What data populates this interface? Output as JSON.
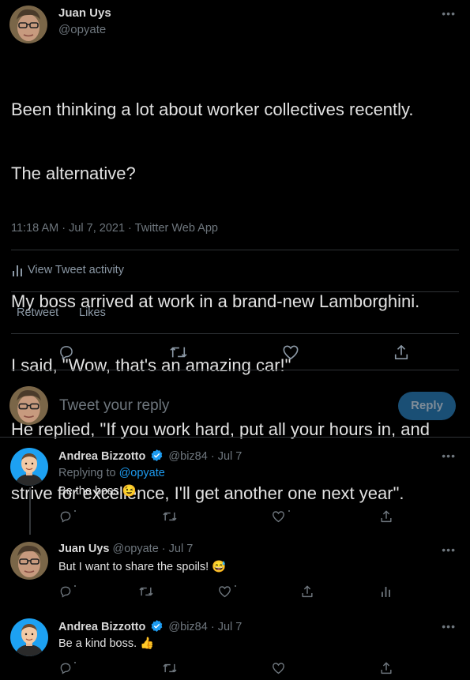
{
  "main_tweet": {
    "author": "Juan Uys",
    "handle": "@opyate",
    "lines": [
      "Been thinking a lot about worker collectives recently.",
      "The alternative?",
      "",
      "My boss arrived at work in a brand-new Lamborghini.",
      "I said, \"Wow, that's an amazing car!\"",
      "He replied, \"If you work hard, put all your hours in, and",
      "strive for excellence, I'll get another one next year\"."
    ],
    "meta": "11:18 AM · Jul 7, 2021 · Twitter Web App",
    "activity_label": "View Tweet activity",
    "stats": {
      "retweet_label": "Retweet",
      "likes_label": "Likes"
    }
  },
  "composer": {
    "placeholder": "Tweet your reply",
    "button_label": "Reply"
  },
  "replies": [
    {
      "author": "Andrea Bizzotto",
      "verified": true,
      "handle_date": "@biz84 · Jul 7",
      "replying_prefix": "Replying to",
      "replying_handle": "@opyate",
      "text": "Be the boss",
      "emoji": "😉"
    },
    {
      "author": "Juan Uys",
      "verified": false,
      "handle_date": "@opyate · Jul 7",
      "text": "But I want to share the spoils!",
      "emoji": "😅"
    },
    {
      "author": "Andrea Bizzotto",
      "verified": true,
      "handle_date": "@biz84 · Jul 7",
      "text": "Be a kind boss.",
      "emoji": "👍"
    }
  ],
  "colors": {
    "background": "#000000",
    "text": "#d9d9d9",
    "muted": "#6e767d",
    "accent": "#1d9bf0",
    "verified": "#1d9bf0",
    "divider": "#2f3336",
    "reply_button_disabled": "#1a4f75"
  },
  "icons": [
    "more-icon",
    "analytics-icon",
    "reply-icon",
    "retweet-icon",
    "like-icon",
    "share-icon",
    "verified-badge-icon"
  ]
}
